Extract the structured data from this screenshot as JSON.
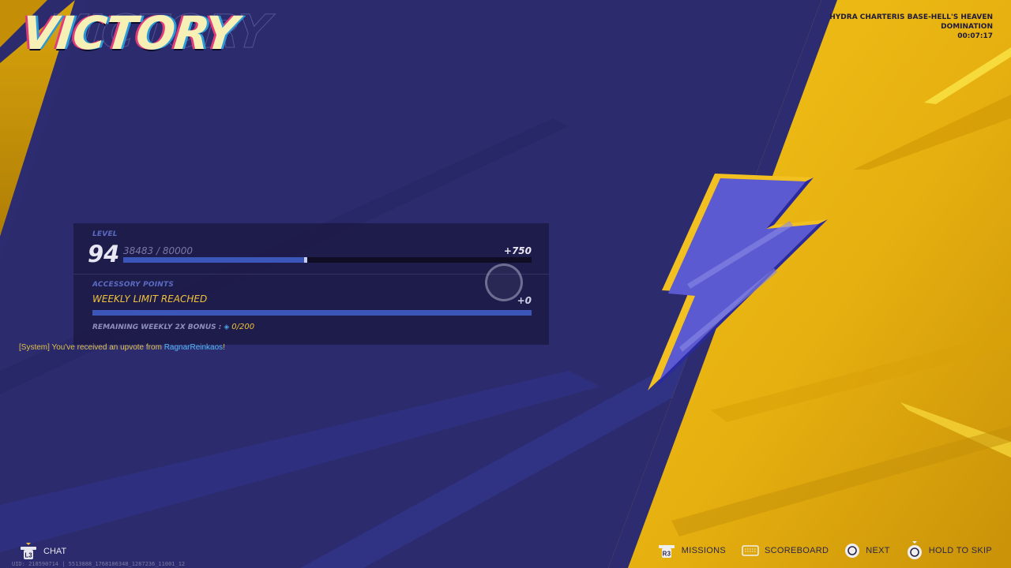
{
  "result": {
    "title": "VICTORY"
  },
  "match": {
    "map": "HYDRA CHARTERIS BASE-HELL'S HEAVEN",
    "mode": "DOMINATION",
    "duration": "00:07:17"
  },
  "progress": {
    "level_label": "LEVEL",
    "level": "94",
    "xp_text": "38483 / 80000",
    "xp_fraction": 0.4466,
    "xp_gain": "+750",
    "accessory_label": "ACCESSORY POINTS",
    "weekly_status": "WEEKLY LIMIT REACHED",
    "accessory_gain": "+0",
    "accessory_fraction": 1.0,
    "bonus_label": "REMAINING WEEKLY 2X BONUS :",
    "bonus_value": "0/200"
  },
  "system_message": {
    "prefix": "[System] You've received an upvote from",
    "player": "RagnarReinkaos",
    "suffix": "!"
  },
  "bottom": {
    "chat_label": "CHAT",
    "chat_button": "L3",
    "uid": "UID: 218590714 | 5513888_1768106348_1287236_11001_12"
  },
  "controls": [
    {
      "button": "R3",
      "label": "MISSIONS",
      "icon": "r3-button-icon"
    },
    {
      "button": "",
      "label": "SCOREBOARD",
      "icon": "touchpad-icon"
    },
    {
      "button": "",
      "label": "NEXT",
      "icon": "circle-button-icon"
    },
    {
      "button": "",
      "label": "HOLD TO SKIP",
      "icon": "hold-circle-button-icon"
    }
  ],
  "colors": {
    "background": "#2b2a6b",
    "accent_yellow": "#f0c020",
    "bolt": "#5a5ac8",
    "bar_fill": "#3b55b8"
  }
}
